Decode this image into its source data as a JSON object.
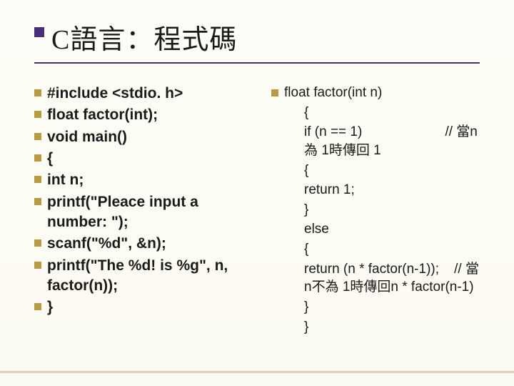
{
  "title": "C語言：程式碼",
  "left": [
    "#include <stdio. h>",
    "float factor(int);",
    "void main()",
    "{",
    "int n;",
    "printf(\"Pleace input a number: \");",
    "scanf(\"%d\", &n);",
    "printf(\"The %d! is %g\", n, factor(n));",
    "}"
  ],
  "right": {
    "head": "float factor(int n)",
    "body": [
      "{",
      "if (n == 1)                      // 當n為 1時傳回 1",
      "{",
      "return 1;",
      "}",
      "else",
      "{",
      "return (n * factor(n-1));    // 當n不為 1時傳回n * factor(n-1)",
      "}",
      "}"
    ]
  }
}
